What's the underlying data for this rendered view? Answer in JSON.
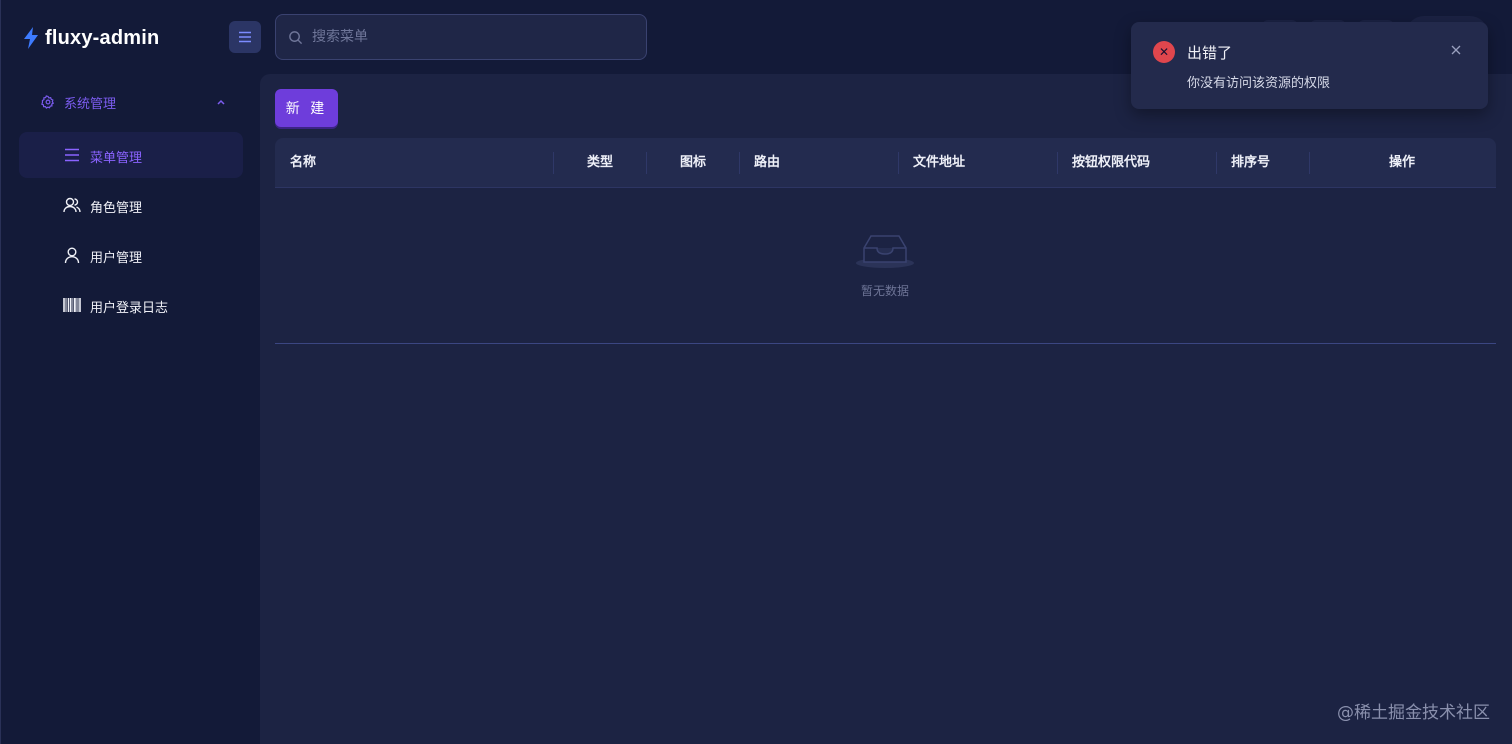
{
  "app": {
    "name": "fluxy-admin"
  },
  "sidebar": {
    "group": {
      "label": "系统管理",
      "icon": "gear-icon",
      "expanded": true
    },
    "items": [
      {
        "label": "菜单管理",
        "icon": "menu-list-icon",
        "active": true
      },
      {
        "label": "角色管理",
        "icon": "users-icon",
        "active": false
      },
      {
        "label": "用户管理",
        "icon": "user-icon",
        "active": false
      },
      {
        "label": "用户登录日志",
        "icon": "barcode-icon",
        "active": false
      }
    ]
  },
  "header": {
    "toggle_icon": "menu-toggle-icon",
    "search": {
      "placeholder": "搜索菜单",
      "value": "",
      "icon": "search-icon"
    }
  },
  "toolbar": {
    "new_label": "新 建"
  },
  "table": {
    "columns": [
      "名称",
      "类型",
      "图标",
      "路由",
      "文件地址",
      "按钮权限代码",
      "排序号",
      "操作"
    ],
    "rows": [],
    "empty_text": "暂无数据"
  },
  "notification": {
    "type": "error",
    "title": "出错了",
    "message": "你没有访问该资源的权限"
  },
  "watermark": "@稀土掘金技术社区",
  "colors": {
    "accent": "#6e3ddb",
    "active_text": "#8a63ff",
    "error": "#e0464d",
    "background": "#131a38",
    "panel": "#1c2343"
  }
}
